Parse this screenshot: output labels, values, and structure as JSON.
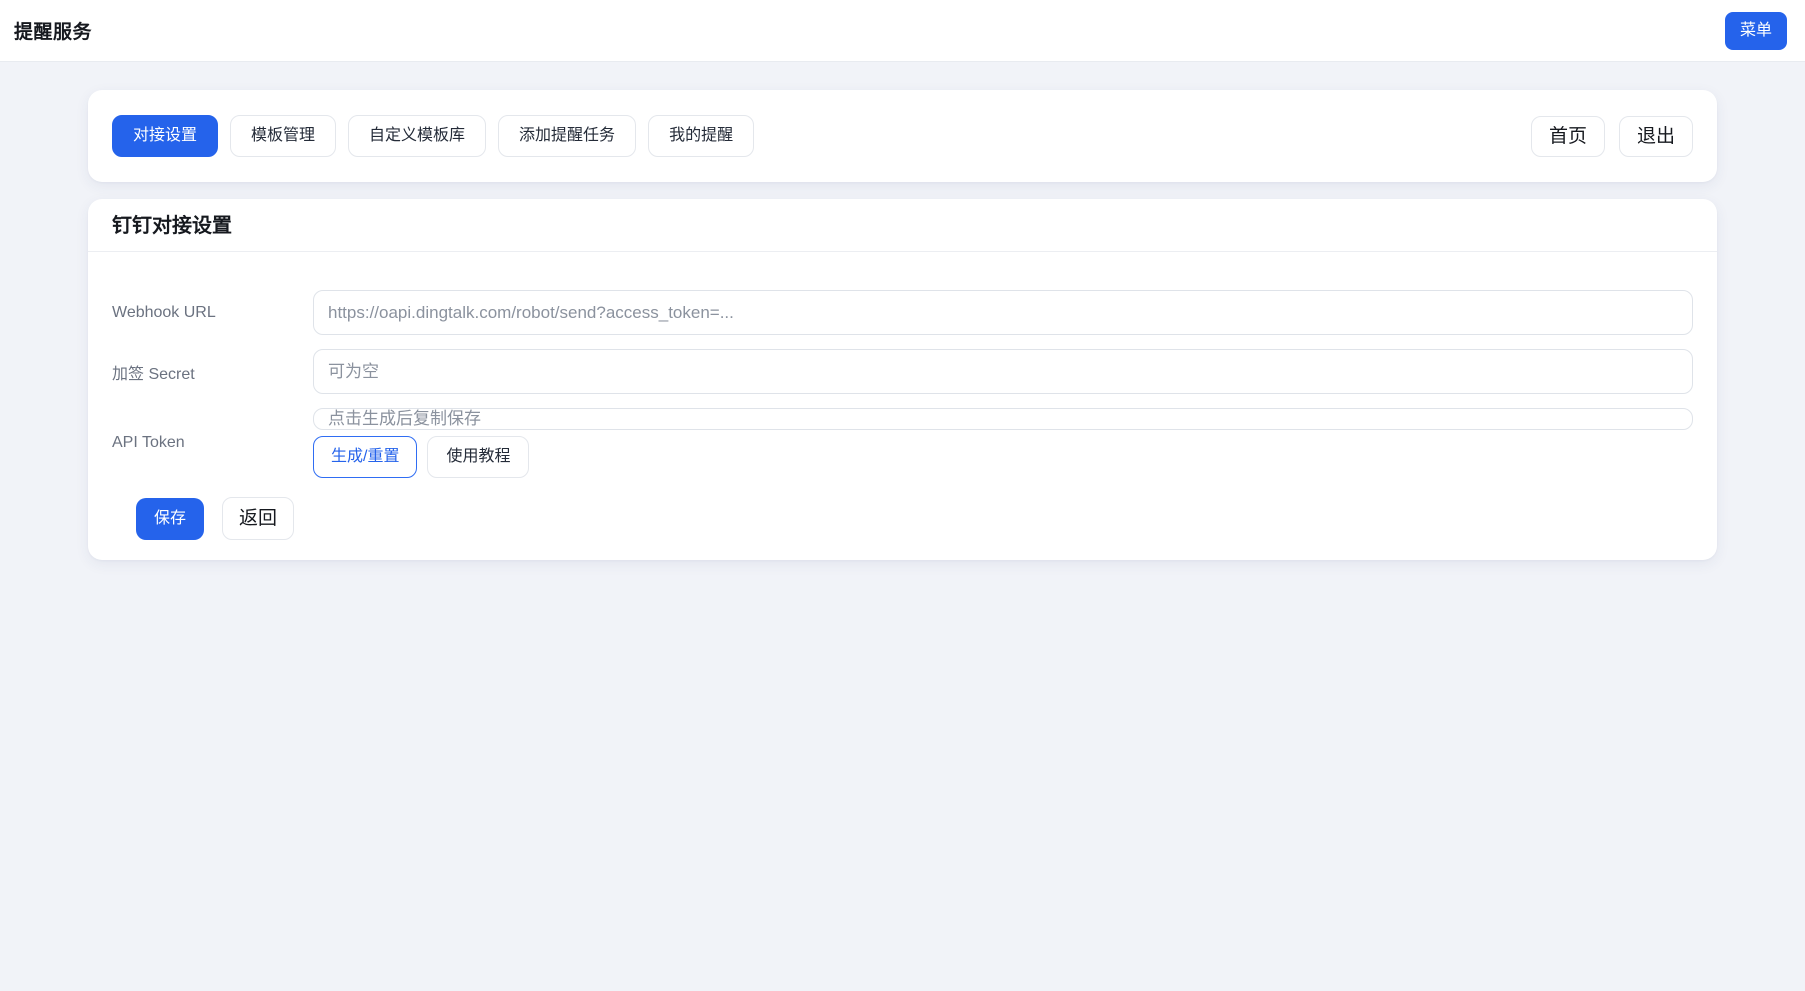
{
  "header": {
    "title": "提醒服务",
    "menu_button": "菜单"
  },
  "nav": {
    "tabs": [
      {
        "label": "对接设置",
        "active": true
      },
      {
        "label": "模板管理",
        "active": false
      },
      {
        "label": "自定义模板库",
        "active": false
      },
      {
        "label": "添加提醒任务",
        "active": false
      },
      {
        "label": "我的提醒",
        "active": false
      }
    ],
    "home_button": "首页",
    "exit_button": "退出"
  },
  "settings_card": {
    "title": "钉钉对接设置",
    "fields": [
      {
        "label": "Webhook URL",
        "value": "",
        "placeholder": "https://oapi.dingtalk.com/robot/send?access_token=..."
      },
      {
        "label": "加签 Secret",
        "value": "",
        "placeholder": "可为空"
      },
      {
        "label": "API Token",
        "value": "",
        "placeholder": "点击生成后复制保存"
      }
    ],
    "generate_button": "生成/重置",
    "tutorial_button": "使用教程",
    "save_button": "保存",
    "back_button": "返回"
  },
  "colors": {
    "accent": "#2563eb",
    "page_background": "#f1f3f8",
    "card_background": "#ffffff"
  }
}
